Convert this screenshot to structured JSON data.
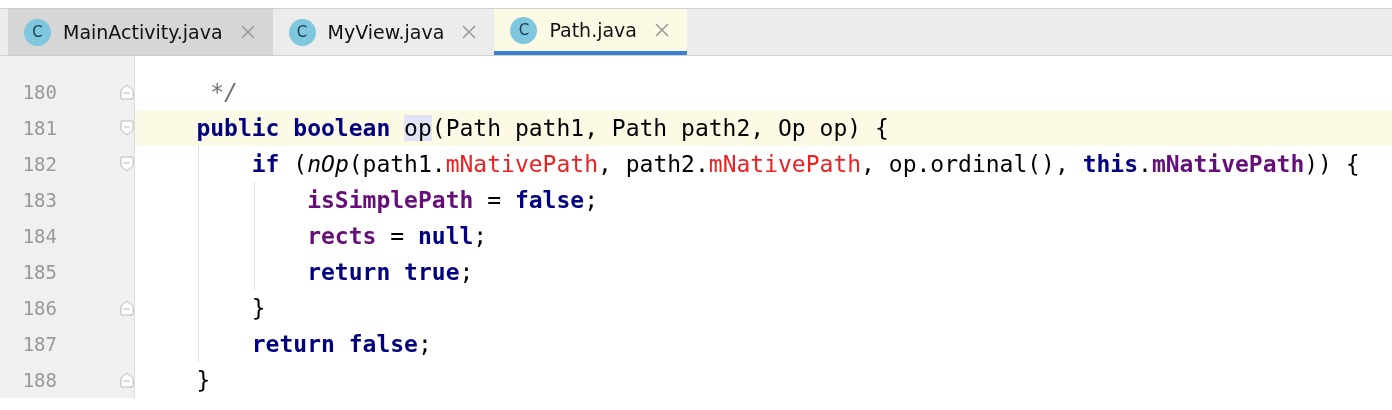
{
  "tabs": [
    {
      "label": "MainActivity.java",
      "icon": "C",
      "selected": false
    },
    {
      "label": "MyView.java",
      "icon": "C",
      "selected": false
    },
    {
      "label": "Path.java",
      "icon": "C",
      "selected": true
    }
  ],
  "lines": [
    {
      "number": "180",
      "current": false,
      "fold_start": false,
      "fold_end": true,
      "tokens": [
        {
          "kind": "comment",
          "text": "     */"
        }
      ]
    },
    {
      "number": "181",
      "current": true,
      "fold_start": true,
      "fold_end": false,
      "tokens": [
        {
          "kind": "keyword",
          "text": "    public boolean "
        },
        {
          "kind": "match",
          "text": "op"
        },
        {
          "kind": "plain",
          "text": "(Path path1, Path path2, Op op) {"
        }
      ]
    },
    {
      "number": "182",
      "current": false,
      "fold_start": true,
      "fold_end": false,
      "tokens": [
        {
          "kind": "keyword",
          "text": "        if"
        },
        {
          "kind": "plain",
          "text": " ("
        },
        {
          "kind": "call",
          "text": "nOp"
        },
        {
          "kind": "plain",
          "text": "(path1."
        },
        {
          "kind": "native",
          "text": "mNativePath"
        },
        {
          "kind": "plain",
          "text": ", path2."
        },
        {
          "kind": "native",
          "text": "mNativePath"
        },
        {
          "kind": "plain",
          "text": ", op.ordinal(), "
        },
        {
          "kind": "keyword",
          "text": "this"
        },
        {
          "kind": "plain",
          "text": "."
        },
        {
          "kind": "field",
          "text": "mNativePath"
        },
        {
          "kind": "plain",
          "text": ")) {"
        }
      ]
    },
    {
      "number": "183",
      "current": false,
      "fold_start": false,
      "fold_end": false,
      "tokens": [
        {
          "kind": "field",
          "text": "            isSimplePath"
        },
        {
          "kind": "plain",
          "text": " = "
        },
        {
          "kind": "keyword",
          "text": "false"
        },
        {
          "kind": "plain",
          "text": ";"
        }
      ]
    },
    {
      "number": "184",
      "current": false,
      "fold_start": false,
      "fold_end": false,
      "tokens": [
        {
          "kind": "field",
          "text": "            rects"
        },
        {
          "kind": "plain",
          "text": " = "
        },
        {
          "kind": "keyword",
          "text": "null"
        },
        {
          "kind": "plain",
          "text": ";"
        }
      ]
    },
    {
      "number": "185",
      "current": false,
      "fold_start": false,
      "fold_end": false,
      "tokens": [
        {
          "kind": "keyword",
          "text": "            return true"
        },
        {
          "kind": "plain",
          "text": ";"
        }
      ]
    },
    {
      "number": "186",
      "current": false,
      "fold_start": false,
      "fold_end": true,
      "tokens": [
        {
          "kind": "plain",
          "text": "        }"
        }
      ]
    },
    {
      "number": "187",
      "current": false,
      "fold_start": false,
      "fold_end": false,
      "tokens": [
        {
          "kind": "keyword",
          "text": "        return false"
        },
        {
          "kind": "plain",
          "text": ";"
        }
      ]
    },
    {
      "number": "188",
      "current": false,
      "fold_start": false,
      "fold_end": true,
      "tokens": [
        {
          "kind": "plain",
          "text": "    }"
        }
      ]
    }
  ]
}
